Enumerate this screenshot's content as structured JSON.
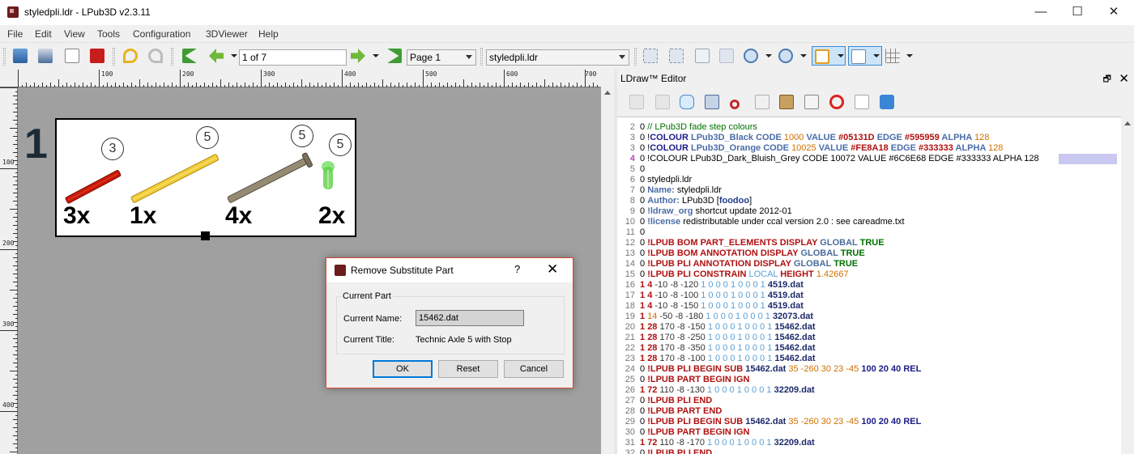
{
  "window": {
    "title": "styledpli.ldr - LPub3D v2.3.11",
    "minimize": "—",
    "maximize": "☐",
    "close": "✕"
  },
  "menu": [
    "File",
    "Edit",
    "View",
    "Tools",
    "Configuration",
    "3DViewer",
    "Help"
  ],
  "toolbar": {
    "page_field": "1 of 7",
    "page_combo": "Page 1",
    "file_combo": "styledpli.ldr",
    "icons": [
      "open-file-icon",
      "save-file-icon",
      "print-preview-icon",
      "pdf-export-icon",
      "undo-icon",
      "redo-icon",
      "first-page-icon",
      "previous-page-icon",
      "next-page-icon",
      "last-page-icon",
      "fit-width-icon",
      "fit-visible-icon",
      "fit-scene-icon",
      "actual-size-icon",
      "zoom-in-icon",
      "zoom-out-icon",
      "page-grid-icon",
      "scene-guides-icon",
      "snap-grid-icon"
    ]
  },
  "ruler": {
    "h_labels": [
      "100",
      "200",
      "300",
      "400",
      "500",
      "600",
      "700"
    ],
    "v_labels": [
      "100",
      "200",
      "300",
      "400"
    ]
  },
  "page": {
    "step_number": "1",
    "parts": [
      {
        "count": "3x",
        "annotation": "3",
        "color": "#c91a09"
      },
      {
        "count": "1x",
        "annotation": "5",
        "color": "#f2cd37"
      },
      {
        "count": "4x",
        "annotation": "5",
        "color": "#958a73"
      },
      {
        "count": "2x",
        "annotation": "5",
        "color": "#4bd13a"
      }
    ]
  },
  "dialog": {
    "title": "Remove Substitute Part",
    "help": "?",
    "close": "✕",
    "group_title": "Current Part",
    "name_label": "Current Name:",
    "name_value": "15462.dat",
    "title_label": "Current Title:",
    "title_value": "Technic Axle  5 with Stop",
    "ok": "OK",
    "reset": "Reset",
    "cancel": "Cancel"
  },
  "editor": {
    "title": "LDraw™ Editor",
    "float": "🗗",
    "close": "✕",
    "icons": [
      "update-icon",
      "download-icon",
      "comment-icon",
      "preferences-icon",
      "cut-icon",
      "copy-icon",
      "paste-icon",
      "find-icon",
      "delete-icon",
      "new-file-icon",
      "refresh-icon"
    ],
    "lines": [
      {
        "n": "2",
        "t": [
          [
            "0 ",
            "zero"
          ],
          [
            "// LPub3D fade step colours",
            "comment"
          ]
        ]
      },
      {
        "n": "3",
        "t": [
          [
            "0 !",
            "zero"
          ],
          [
            "COLOUR ",
            "kwb"
          ],
          [
            "LPub3D_Black ",
            "head"
          ],
          [
            "CODE ",
            "head"
          ],
          [
            "1000 ",
            "num"
          ],
          [
            "VALUE ",
            "head"
          ],
          [
            "#05131D ",
            "kw"
          ],
          [
            "EDGE ",
            "head"
          ],
          [
            "#595959 ",
            "kw"
          ],
          [
            "ALPHA ",
            "head"
          ],
          [
            "128",
            "num"
          ]
        ]
      },
      {
        "n": "3",
        "t": [
          [
            "0 !",
            "zero"
          ],
          [
            "COLOUR ",
            "kwb"
          ],
          [
            "LPub3D_Orange ",
            "head"
          ],
          [
            "CODE ",
            "head"
          ],
          [
            "10025 ",
            "num"
          ],
          [
            "VALUE ",
            "head"
          ],
          [
            "#FE8A18 ",
            "kw"
          ],
          [
            "EDGE ",
            "head"
          ],
          [
            "#333333 ",
            "kw"
          ],
          [
            "ALPHA ",
            "head"
          ],
          [
            "128",
            "num"
          ]
        ]
      },
      {
        "n": "4",
        "cur": true,
        "t": [
          [
            "0 !",
            "zero"
          ],
          [
            "COLOUR LPub3D_Dark_Bluish_Grey CODE ",
            "meta"
          ],
          [
            "10072 ",
            "black"
          ],
          [
            "VALUE #6C6E68 EDGE #333333 ALPHA ",
            "meta"
          ],
          [
            "128",
            "black"
          ]
        ]
      },
      {
        "n": "5",
        "t": [
          [
            "0",
            "zero"
          ]
        ]
      },
      {
        "n": "6",
        "t": [
          [
            "0 styledpli.ldr",
            "zero"
          ]
        ]
      },
      {
        "n": "7",
        "t": [
          [
            "0 ",
            "zero"
          ],
          [
            "Name: ",
            "head"
          ],
          [
            "styledpli.ldr",
            "headval"
          ]
        ]
      },
      {
        "n": "8",
        "t": [
          [
            "0 ",
            "zero"
          ],
          [
            "Author: ",
            "head"
          ],
          [
            "LPub3D [",
            "headval"
          ],
          [
            "foodoo",
            "hex"
          ],
          [
            "]",
            "headval"
          ]
        ]
      },
      {
        "n": "9",
        "t": [
          [
            "0 ",
            "zero"
          ],
          [
            "!ldraw_org ",
            "head"
          ],
          [
            "shortcut update 2012-01",
            "headval"
          ]
        ]
      },
      {
        "n": "10",
        "t": [
          [
            "0 ",
            "zero"
          ],
          [
            "!license ",
            "head"
          ],
          [
            "redistributable under ccal version 2.0 : see careadme.txt",
            "headval"
          ]
        ]
      },
      {
        "n": "11",
        "t": [
          [
            "0",
            "zero"
          ]
        ]
      },
      {
        "n": "12",
        "t": [
          [
            "0 ",
            "zero"
          ],
          [
            "!LPUB BOM PART_ELEMENTS DISPLAY ",
            "kw"
          ],
          [
            "GLOBAL ",
            "global"
          ],
          [
            "TRUE",
            "true"
          ]
        ]
      },
      {
        "n": "13",
        "t": [
          [
            "0 ",
            "zero"
          ],
          [
            "!LPUB BOM ANNOTATION DISPLAY ",
            "kw"
          ],
          [
            "GLOBAL ",
            "global"
          ],
          [
            "TRUE",
            "true"
          ]
        ]
      },
      {
        "n": "14",
        "t": [
          [
            "0 ",
            "zero"
          ],
          [
            "!LPUB PLI ANNOTATION DISPLAY ",
            "kw"
          ],
          [
            "GLOBAL ",
            "global"
          ],
          [
            "TRUE",
            "true"
          ]
        ]
      },
      {
        "n": "15",
        "t": [
          [
            "0 ",
            "zero"
          ],
          [
            "!LPUB PLI CONSTRAIN ",
            "kw"
          ],
          [
            "LOCAL ",
            "rot"
          ],
          [
            "HEIGHT ",
            "kw"
          ],
          [
            "1.42667",
            "num"
          ]
        ]
      },
      {
        "n": "16",
        "t": [
          [
            "1 ",
            "red"
          ],
          [
            "4 ",
            "red"
          ],
          [
            "-10 -8 -120 ",
            "pos"
          ],
          [
            "1 0 0 0 1 0 0 0 1 ",
            "rot"
          ],
          [
            "4519.dat",
            "dat"
          ]
        ]
      },
      {
        "n": "17",
        "t": [
          [
            "1 ",
            "red"
          ],
          [
            "4 ",
            "red"
          ],
          [
            "-10 -8 -100 ",
            "pos"
          ],
          [
            "1 0 0 0 1 0 0 0 1 ",
            "rot"
          ],
          [
            "4519.dat",
            "dat"
          ]
        ]
      },
      {
        "n": "18",
        "t": [
          [
            "1 ",
            "red"
          ],
          [
            "4 ",
            "red"
          ],
          [
            "-10 -8 -150 ",
            "pos"
          ],
          [
            "1 0 0 0 1 0 0 0 1 ",
            "rot"
          ],
          [
            "4519.dat",
            "dat"
          ]
        ]
      },
      {
        "n": "19",
        "t": [
          [
            "1 ",
            "red"
          ],
          [
            "14 ",
            "num"
          ],
          [
            "-50 -8 -180 ",
            "pos"
          ],
          [
            "1 0 0 0 1 0 0 0 1 ",
            "rot"
          ],
          [
            "32073.dat",
            "dat"
          ]
        ]
      },
      {
        "n": "20",
        "t": [
          [
            "1 ",
            "red"
          ],
          [
            "28 ",
            "red"
          ],
          [
            "170 -8 -150 ",
            "pos"
          ],
          [
            "1 0 0 0 1 0 0 0 1 ",
            "rot"
          ],
          [
            "15462.dat",
            "dat"
          ]
        ]
      },
      {
        "n": "21",
        "t": [
          [
            "1 ",
            "red"
          ],
          [
            "28 ",
            "red"
          ],
          [
            "170 -8 -250 ",
            "pos"
          ],
          [
            "1 0 0 0 1 0 0 0 1 ",
            "rot"
          ],
          [
            "15462.dat",
            "dat"
          ]
        ]
      },
      {
        "n": "22",
        "t": [
          [
            "1 ",
            "red"
          ],
          [
            "28 ",
            "red"
          ],
          [
            "170 -8 -350 ",
            "pos"
          ],
          [
            "1 0 0 0 1 0 0 0 1 ",
            "rot"
          ],
          [
            "15462.dat",
            "dat"
          ]
        ]
      },
      {
        "n": "23",
        "t": [
          [
            "1 ",
            "red"
          ],
          [
            "28 ",
            "red"
          ],
          [
            "170 -8 -100 ",
            "pos"
          ],
          [
            "1 0 0 0 1 0 0 0 1 ",
            "rot"
          ],
          [
            "15462.dat",
            "dat"
          ]
        ]
      },
      {
        "n": "24",
        "t": [
          [
            "0 ",
            "zero"
          ],
          [
            "!LPUB PLI BEGIN SUB ",
            "kw"
          ],
          [
            "15462.dat ",
            "dat"
          ],
          [
            "35 ",
            "num"
          ],
          [
            "-260 30 23 -45 ",
            "num"
          ],
          [
            "100 20 40 ",
            "kwb"
          ],
          [
            "REL",
            "kwb"
          ]
        ]
      },
      {
        "n": "25",
        "t": [
          [
            "0 ",
            "zero"
          ],
          [
            "!LPUB PART BEGIN IGN",
            "kw"
          ]
        ]
      },
      {
        "n": "26",
        "t": [
          [
            "1 ",
            "red"
          ],
          [
            "72 ",
            "red"
          ],
          [
            "110 -8 -130 ",
            "pos"
          ],
          [
            "1 0 0 0 1 0 0 0 1 ",
            "rot"
          ],
          [
            "32209.dat",
            "dat"
          ]
        ]
      },
      {
        "n": "27",
        "t": [
          [
            "0 ",
            "zero"
          ],
          [
            "!LPUB PLI END",
            "kw"
          ]
        ]
      },
      {
        "n": "28",
        "t": [
          [
            "0 ",
            "zero"
          ],
          [
            "!LPUB PART END",
            "kw"
          ]
        ]
      },
      {
        "n": "29",
        "t": [
          [
            "0 ",
            "zero"
          ],
          [
            "!LPUB PLI BEGIN SUB ",
            "kw"
          ],
          [
            "15462.dat ",
            "dat"
          ],
          [
            "35 ",
            "num"
          ],
          [
            "-260 30 23 -45 ",
            "num"
          ],
          [
            "100 20 40 ",
            "kwb"
          ],
          [
            "REL",
            "kwb"
          ]
        ]
      },
      {
        "n": "30",
        "t": [
          [
            "0 ",
            "zero"
          ],
          [
            "!LPUB PART BEGIN IGN",
            "kw"
          ]
        ]
      },
      {
        "n": "31",
        "t": [
          [
            "1 ",
            "red"
          ],
          [
            "72 ",
            "red"
          ],
          [
            "110 -8 -170 ",
            "pos"
          ],
          [
            "1 0 0 0 1 0 0 0 1 ",
            "rot"
          ],
          [
            "32209.dat",
            "dat"
          ]
        ]
      },
      {
        "n": "32",
        "t": [
          [
            "0 ",
            "zero"
          ],
          [
            "!LPUB PLI END",
            "kw"
          ]
        ]
      }
    ]
  }
}
